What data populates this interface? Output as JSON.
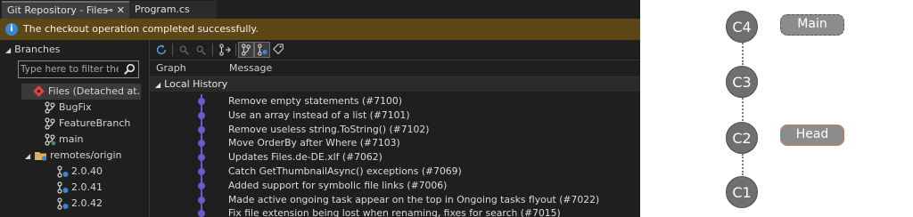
{
  "tabs": [
    {
      "label": "Git Repository - Files",
      "active": true
    },
    {
      "label": "Program.cs",
      "active": false
    }
  ],
  "tab_icons": {
    "pin": "⊸",
    "close": "✕"
  },
  "infobar": {
    "message": "The checkout operation completed successfully.",
    "icon": "info-icon",
    "color": "#5e4717"
  },
  "branches": {
    "title": "Branches",
    "filter_placeholder": "Type here to filter the",
    "items": [
      {
        "label": "Files (Detached at...",
        "icon": "detached-head-icon"
      },
      {
        "label": "BugFix",
        "icon": "branch-icon"
      },
      {
        "label": "FeatureBranch",
        "icon": "branch-icon"
      },
      {
        "label": "main",
        "icon": "branch-icon"
      },
      {
        "label": "remotes/origin",
        "icon": "folder-icon"
      },
      {
        "label": "2.0.40",
        "icon": "remote-branch-icon"
      },
      {
        "label": "2.0.41",
        "icon": "remote-branch-icon"
      },
      {
        "label": "2.0.42",
        "icon": "remote-branch-icon"
      }
    ]
  },
  "graph": {
    "columns": {
      "graph": "Graph",
      "message": "Message"
    },
    "group": "Local History",
    "commits": [
      "Remove empty statements (#7100)",
      "Use an array instead of a list (#7101)",
      "Remove useless string.ToString() (#7102)",
      "Move OrderBy after Where (#7103)",
      "Updates Files.de-DE.xlf (#7062)",
      "Catch GetThumbnailAsync() exceptions (#7069)",
      "Added support for symbolic file links (#7006)",
      "Made active ongoing task appear on the top in Ongoing tasks flyout (#7022)",
      "Fix file extension being lost when renaming, fixes for search (#7015)"
    ],
    "line_color": "#6a5acd"
  },
  "diagram": {
    "nodes": [
      "C4",
      "C3",
      "C2",
      "C1"
    ],
    "labels": {
      "main": "Main",
      "head": "Head"
    },
    "colors": {
      "node": "#6f6f6f",
      "main_fill": "#8c8c8c",
      "head_fill": "#8c8c8c",
      "head_border": "#e8743b",
      "main_border": "#555555"
    }
  }
}
